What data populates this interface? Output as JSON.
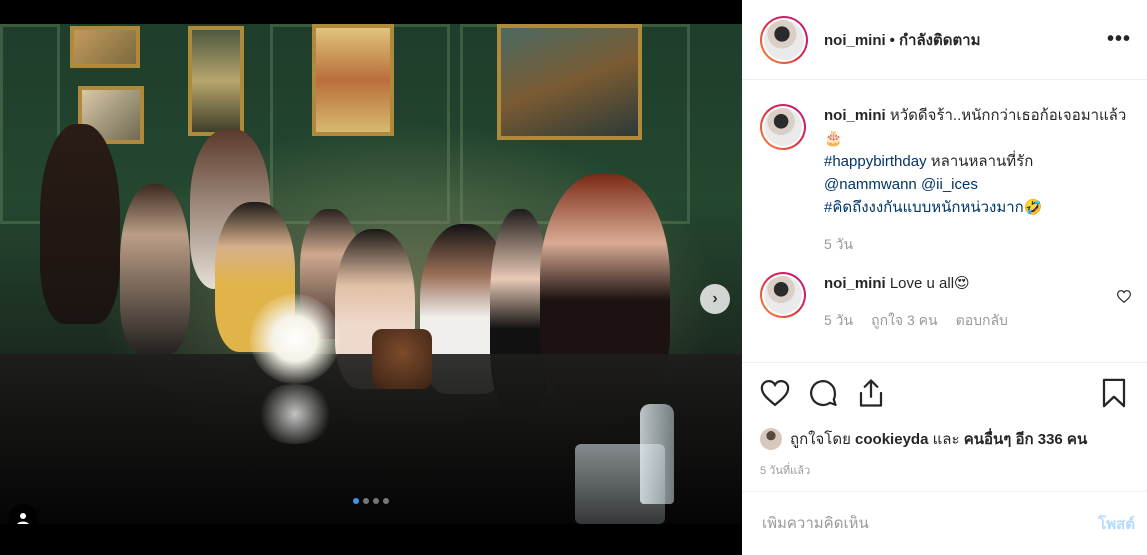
{
  "post": {
    "username": "noi_mini",
    "separator": "•",
    "follow_status": "กำลังติดตาม",
    "more_icon": "more-options-icon",
    "more_label": "•••"
  },
  "carousel": {
    "page_count": 4,
    "active_index": 0,
    "next_label": "›"
  },
  "caption": {
    "username": "noi_mini",
    "line1": "หวัดดีจร้า..หนักกว่าเธอก้อเจอมาแล้ว🎂",
    "hashtag": "#happybirthday",
    "line2_rest": " หลานหลานที่รัก",
    "mention1": "@nammwann",
    "mention2": "@ii_ices",
    "hashtag2": "#คิดถึงงงกันแบบหนักหน่วงมาก🤣",
    "time": "5 วัน"
  },
  "reply": {
    "username": "noi_mini",
    "text": "Love u all😍",
    "time": "5 วัน",
    "likes": "ถูกใจ 3 คน",
    "reply_label": "ตอบกลับ"
  },
  "likes_line": {
    "prefix": "ถูกใจโดย",
    "user": "cookieyda",
    "middle": "และ",
    "others": "คนอื่นๆ อีก 336 คน"
  },
  "posted_time": "5 วันที่แล้ว",
  "comment_box": {
    "placeholder": "เพิ่มความคิดเห็น",
    "post_label": "โพสต์"
  },
  "colors": {
    "link": "#003569",
    "muted": "#999999",
    "post_disabled": "#b3dbff",
    "carousel_active": "#3897f0"
  }
}
